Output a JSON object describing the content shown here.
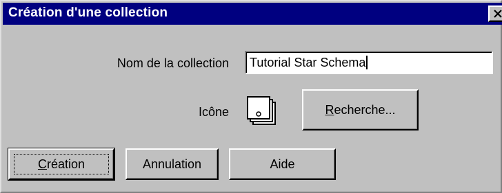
{
  "window": {
    "title": "Création d'une collection"
  },
  "form": {
    "name_label": "Nom de la collection",
    "name_value": "Tutorial Star Schema",
    "icon_label": "Icône"
  },
  "buttons": {
    "search_mnemonic": "R",
    "search_rest": "echerche...",
    "create_mnemonic": "C",
    "create_rest": "réation",
    "cancel_label": "Annulation",
    "help_label": "Aide"
  },
  "icons": {
    "close": "close-icon",
    "collection": "collection-stack-icon"
  },
  "colors": {
    "titlebar": "#000080",
    "face": "#c0c0c0"
  }
}
